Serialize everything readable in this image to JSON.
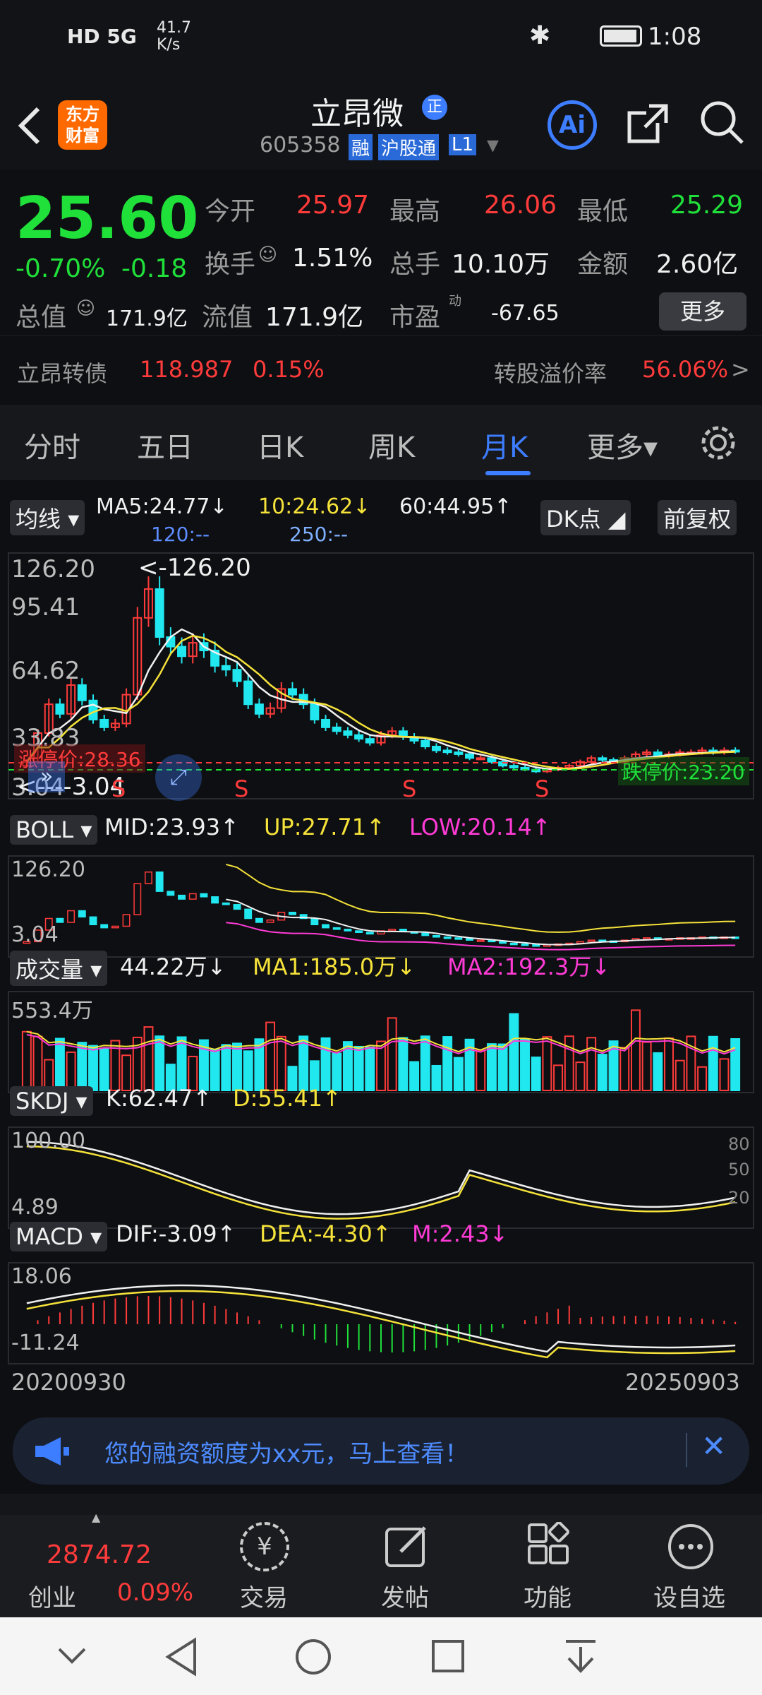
{
  "status": {
    "signal": "HD 5G",
    "speed_value": "41.7",
    "speed_unit": "K/s",
    "time": "1:08"
  },
  "header": {
    "app_badge": "东方财富",
    "stock_name": "立昂微",
    "badge": "正",
    "code": "605358",
    "tags": [
      "融",
      "沪股通",
      "L1"
    ],
    "ai_label": "Ai"
  },
  "quote": {
    "price": "25.60",
    "change_pct": "-0.70%",
    "change": "-0.18",
    "open_label": "今开",
    "open": "25.97",
    "high_label": "最高",
    "high": "26.06",
    "low_label": "最低",
    "low": "25.29",
    "turnover_label": "换手",
    "turnover": "1.51%",
    "volume_label": "总手",
    "volume": "10.10万",
    "amount_label": "金额",
    "amount": "2.60亿",
    "mktcap_label": "总值",
    "mktcap": "171.9亿",
    "float_label": "流值",
    "float": "171.9亿",
    "pe_label": "市盈",
    "pe_sup": "动",
    "pe": "-67.65",
    "more_label": "更多"
  },
  "bond": {
    "name": "立昂转债",
    "price": "118.987",
    "change": "0.15%",
    "premium_label": "转股溢价率",
    "premium": "56.06%",
    "arrow": ">"
  },
  "tabs": {
    "items": [
      "分时",
      "五日",
      "日K",
      "周K",
      "月K",
      "更多▾"
    ],
    "active": 4
  },
  "kline": {
    "ma_type": "均线",
    "ma5": "MA5:24.77↓",
    "ma10": "10:24.62↓",
    "ma60": "60:44.95↑",
    "ma120": "120:--",
    "ma250": "250:--",
    "dk_label": "DK点",
    "adjust_label": "前复权",
    "y_labels": [
      "126.20",
      "95.41",
      "64.62",
      "33.83",
      "3.04"
    ],
    "max_marker": "<-126.20",
    "min_marker": "<----3.04",
    "limit_up": "涨停价:28.36",
    "limit_down": "跌停价:23.20",
    "signals": [
      "S",
      "S",
      "S",
      "S"
    ]
  },
  "boll": {
    "name": "BOLL",
    "mid": "MID:23.93↑",
    "up": "UP:27.71↑",
    "low": "LOW:20.14↑",
    "y_labels": [
      "126.20",
      "3.04"
    ]
  },
  "volume": {
    "name": "成交量",
    "value": "44.22万↓",
    "ma1": "MA1:185.0万↓",
    "ma2": "MA2:192.3万↓",
    "y_label": "553.4万"
  },
  "skdj": {
    "name": "SKDJ",
    "k": "K:62.47↑",
    "d": "D:55.41↑",
    "y_labels": [
      "100.00",
      "4.89"
    ],
    "right_labels": [
      "80",
      "50",
      "20"
    ]
  },
  "macd": {
    "name": "MACD",
    "dif": "DIF:-3.09↑",
    "dea": "DEA:-4.30↑",
    "m": "M:2.43↓",
    "y_labels": [
      "18.06",
      "-11.24"
    ]
  },
  "dates": {
    "start": "20200930",
    "end": "20250903"
  },
  "banner": {
    "text": "您的融资额度为xx元，马上查看！",
    "close": "✕"
  },
  "index": {
    "value": "2874.72",
    "name": "创业",
    "change": "0.09%"
  },
  "bottomnav": [
    {
      "label": "交易",
      "icon": "yen-circle-icon"
    },
    {
      "label": "发帖",
      "icon": "edit-icon"
    },
    {
      "label": "功能",
      "icon": "grid-icon"
    },
    {
      "label": "设自选",
      "icon": "more-circle-icon"
    }
  ],
  "colors": {
    "up": "#ff3b3b",
    "down": "#21e7ef",
    "ma5": "#f0f0f0",
    "ma10": "#f5e23a",
    "ma60": "#ff3bd6",
    "accent": "#3d7dff"
  }
}
